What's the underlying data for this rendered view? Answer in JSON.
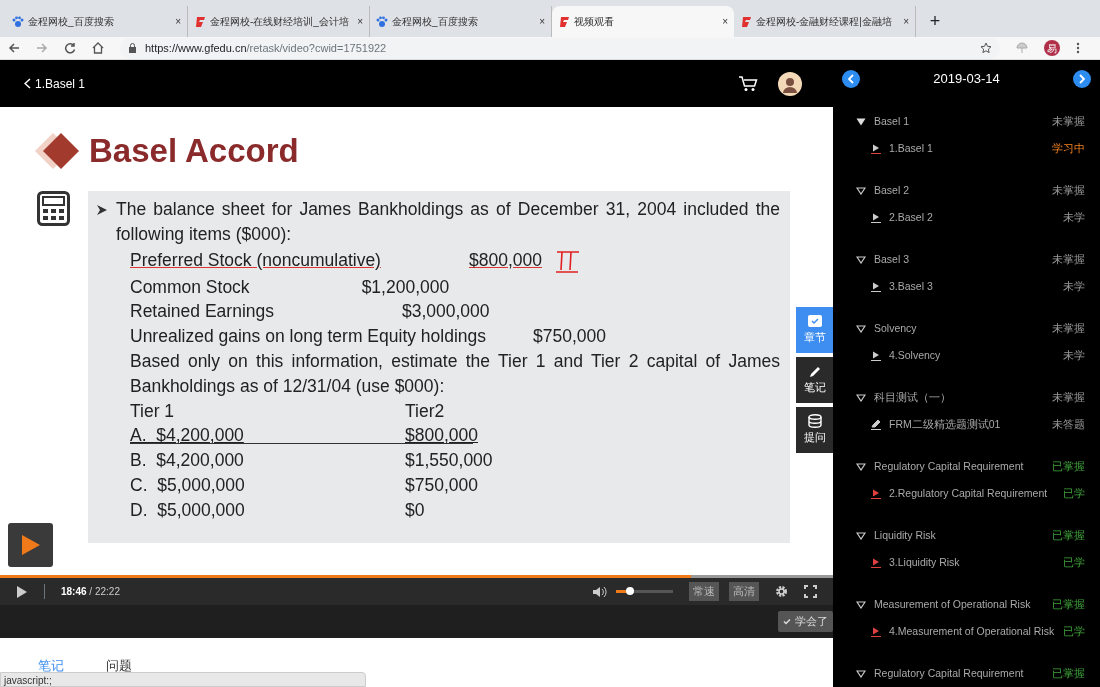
{
  "browser_tabs": [
    {
      "title": "金程网校_百度搜索",
      "kind": "baidu",
      "close": "×",
      "selected": false
    },
    {
      "title": "金程网校-在线财经培训_会计培",
      "kind": "gfedu",
      "close": "×",
      "selected": false
    },
    {
      "title": "金程网校_百度搜索",
      "kind": "baidu",
      "close": "×",
      "selected": false
    },
    {
      "title": "视频观看",
      "kind": "gfedu",
      "close": "×",
      "selected": true
    },
    {
      "title": "金程网校-金融财经课程|金融培",
      "kind": "gfedu",
      "close": "×",
      "selected": false
    }
  ],
  "new_tab": "+",
  "address_bar": {
    "host": "https://www.gfedu.cn",
    "path": "/retask/video?cwid=1751922",
    "profile": "易"
  },
  "player_header": {
    "back_label": "1.Basel 1"
  },
  "slide": {
    "title": "Basel Accord",
    "intro": "The balance sheet for James Bankholdings as of December 31, 2004 included the following items ($000):",
    "items": [
      {
        "label": "Preferred Stock (noncumulative)",
        "value": "$800,000",
        "annotated": true
      },
      {
        "label": "Common Stock",
        "value": "$1,200,000",
        "annotated": false
      },
      {
        "label": "Retained Earnings",
        "value": "$3,000,000",
        "annotated": false
      },
      {
        "label": "Unrealized gains on long term Equity holdings",
        "value": "$750,000",
        "annotated": false
      }
    ],
    "question": "Based only on this information, estimate the Tier 1 and Tier 2 capital of James Bankholdings as of 12/31/04 (use $000):",
    "answer_headers": [
      "Tier 1",
      "Tier2"
    ],
    "answers": [
      {
        "letter": "A.",
        "tier1": "$4,200,000",
        "tier2": "$800,000",
        "underlined": true
      },
      {
        "letter": "B.",
        "tier1": "$4,200,000",
        "tier2": "$1,550,000",
        "underlined": false
      },
      {
        "letter": "C.",
        "tier1": "$5,000,000",
        "tier2": "$750,000",
        "underlined": false
      },
      {
        "letter": "D.",
        "tier1": "$5,000,000",
        "tier2": "$0",
        "underlined": false
      }
    ]
  },
  "side_tools": [
    {
      "label": "章节",
      "kind": "chapters",
      "selected": true
    },
    {
      "label": "笔记",
      "kind": "notes",
      "selected": false
    },
    {
      "label": "提问",
      "kind": "questions",
      "selected": false
    }
  ],
  "controls": {
    "current_time": "18:46",
    "total_time": "/ 22:22",
    "progress": {
      "level": 0.83
    },
    "volume": {
      "level": 0.25
    },
    "speed": "常速",
    "quality": "高清",
    "mastered_button": "学会了"
  },
  "note_tabs": [
    {
      "label": "笔记",
      "selected": true
    },
    {
      "label": "问题",
      "selected": false
    }
  ],
  "status_tooltip": "javascript:;",
  "sidebar": {
    "date": "2019-03-14",
    "chapters": [
      {
        "title": "Basel 1",
        "status": "未掌握",
        "mastered": false,
        "selected": true,
        "children": [
          {
            "kind": "video",
            "title": "1.Basel 1",
            "status": "学习中",
            "in_progress": true,
            "learned": false
          }
        ]
      },
      {
        "title": "Basel 2",
        "status": "未掌握",
        "mastered": false,
        "selected": false,
        "children": [
          {
            "kind": "video",
            "title": "2.Basel 2",
            "status": "未学",
            "in_progress": false,
            "learned": false
          }
        ]
      },
      {
        "title": "Basel 3",
        "status": "未掌握",
        "mastered": false,
        "selected": false,
        "children": [
          {
            "kind": "video",
            "title": "3.Basel 3",
            "status": "未学",
            "in_progress": false,
            "learned": false
          }
        ]
      },
      {
        "title": "Solvency",
        "status": "未掌握",
        "mastered": false,
        "selected": false,
        "children": [
          {
            "kind": "video",
            "title": "4.Solvency",
            "status": "未学",
            "in_progress": false,
            "learned": false
          }
        ]
      },
      {
        "title": "科目测试（一）",
        "status": "未掌握",
        "mastered": false,
        "selected": false,
        "children": [
          {
            "kind": "quiz",
            "title": "FRM二级精选题测试01",
            "status": "未答题",
            "in_progress": false,
            "learned": false
          }
        ]
      },
      {
        "title": "Regulatory Capital Requirement",
        "status": "已掌握",
        "mastered": true,
        "selected": false,
        "children": [
          {
            "kind": "video",
            "title": "2.Regulatory Capital Requirement",
            "status": "已学",
            "in_progress": false,
            "learned": true
          }
        ]
      },
      {
        "title": "Liquidity Risk",
        "status": "已掌握",
        "mastered": true,
        "selected": false,
        "children": [
          {
            "kind": "video",
            "title": "3.Liquidity Risk",
            "status": "已学",
            "in_progress": false,
            "learned": true
          }
        ]
      },
      {
        "title": "Measurement of Operational Risk",
        "status": "已掌握",
        "mastered": true,
        "selected": false,
        "children": [
          {
            "kind": "video",
            "title": "4.Measurement of Operational Risk",
            "status": "已学",
            "in_progress": false,
            "learned": true
          }
        ]
      },
      {
        "title": "Regulatory Capital Requirement",
        "status": "已掌握",
        "mastered": true,
        "selected": false
      }
    ]
  }
}
